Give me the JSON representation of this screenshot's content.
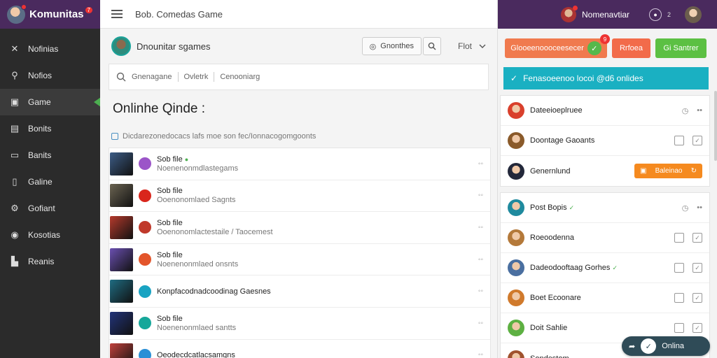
{
  "brand": {
    "name": "Komunitas",
    "badge": "7"
  },
  "sidebar": {
    "items": [
      {
        "label": "Nofinias",
        "icon": "tools-icon",
        "glyph": "✕"
      },
      {
        "label": "Nofios",
        "icon": "bell-icon",
        "glyph": "⚲"
      },
      {
        "label": "Game",
        "icon": "gamepad-icon",
        "glyph": "▣",
        "active": true
      },
      {
        "label": "Bonits",
        "icon": "chat-icon",
        "glyph": "▤"
      },
      {
        "label": "Banits",
        "icon": "window-icon",
        "glyph": "▭"
      },
      {
        "label": "Galine",
        "icon": "book-icon",
        "glyph": "▯"
      },
      {
        "label": "Gofiant",
        "icon": "settings-icon",
        "glyph": "⚙"
      },
      {
        "label": "Kosotias",
        "icon": "target-icon",
        "glyph": "◉"
      },
      {
        "label": "Reanis",
        "icon": "flag-icon",
        "glyph": "▙"
      }
    ]
  },
  "center": {
    "topbar_title": "Bob. Comedas Game",
    "group_name": "Dnounitar sgames",
    "btn_label": "Gnonthes",
    "filter_label": "Flot",
    "search": {
      "placeholder": "Gnenagane",
      "tab2": "Ovletrk",
      "tab3": "Cenooniarg"
    },
    "main_title": "Onlinhe Qinde :",
    "info_text": "Dicdarezonedocacs lafs moe son fec/Ionnacogomgoonts",
    "rows": [
      {
        "title": "Sob file",
        "sub": "Noenenonmdlastegams",
        "check": true,
        "thumb": "#3c5c86",
        "pip": "#9b55c8"
      },
      {
        "title": "Sob file",
        "sub": "Ooenonomlaed Sagnts",
        "check": false,
        "thumb": "#6b6452",
        "pip": "#d9261c"
      },
      {
        "title": "Sob file",
        "sub": "Ooenonomlactestaile / Taocemest",
        "check": false,
        "thumb": "#b53a2c",
        "pip": "#c0392b"
      },
      {
        "title": "Sob file",
        "sub": "Noenenonmlaed onsnts",
        "check": false,
        "thumb": "#6a4fb0",
        "pip": "#e3552b"
      },
      {
        "title": "",
        "sub": "Konpfacodnadcoodinag Gaesnes",
        "check": false,
        "thumb": "#1f6c82",
        "pip": "#19a3c2"
      },
      {
        "title": "Sob file",
        "sub": "Noenenonmlaed santts",
        "check": false,
        "thumb": "#22347a",
        "pip": "#16a79a"
      },
      {
        "title": "",
        "sub": "Oeodecdcatlacsamgns",
        "check": false,
        "thumb": "#c0413c",
        "pip": "#2a8fd6"
      }
    ]
  },
  "right": {
    "username": "Nomenavtiar",
    "user_count": "2",
    "action1": "Glooeenoooceesecer",
    "action1_badge": "9",
    "action2": "Rrfoea",
    "action3": "Gi Santrer",
    "banner": "Fenasoeenoo locoi @d6 onlides",
    "friends_top": [
      {
        "name": "Dateeioeplruee",
        "color": "#d9402c",
        "kind": "icons"
      },
      {
        "name": "Doontage Gaoants",
        "color": "#8a5a2a",
        "kind": "boxes"
      },
      {
        "name": "Genernlund",
        "color": "#23283a",
        "kind": "button",
        "button": "Baleinao"
      }
    ],
    "friends_bottom": [
      {
        "name": "Post Bopis",
        "color": "#1f8a9e",
        "kind": "icons",
        "check": true
      },
      {
        "name": "Roeoodenna",
        "color": "#b4793a",
        "kind": "boxes"
      },
      {
        "name": "Dadeodooftaag Gorhes",
        "color": "#4a6fa0",
        "kind": "boxes",
        "check": true
      },
      {
        "name": "Boet Ecoonare",
        "color": "#d07a2c",
        "kind": "boxes"
      },
      {
        "name": "Doit Sahlie",
        "color": "#5db042",
        "kind": "boxes"
      },
      {
        "name": "Sondestom",
        "color": "#a0522d",
        "kind": "none"
      }
    ],
    "online_label": "Onlina"
  },
  "colors": {
    "sidebar_bg": "#2b2b2b",
    "brand_bg": "#4a2a5e",
    "accent_green": "#4caf50",
    "banner_teal": "#1ab0c2",
    "orange": "#f58a1f"
  }
}
